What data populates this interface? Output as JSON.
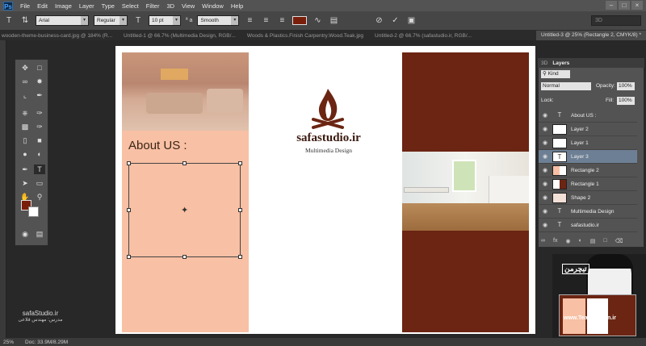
{
  "app": {
    "logo": "Ps"
  },
  "menu": [
    "File",
    "Edit",
    "Image",
    "Layer",
    "Type",
    "Select",
    "Filter",
    "3D",
    "View",
    "Window",
    "Help"
  ],
  "window_controls": [
    "–",
    "□",
    "×"
  ],
  "options": {
    "font_family": "Arial",
    "font_style": "Regular",
    "font_size": "10 pt",
    "aa_label": "ª a",
    "anti_alias": "Smooth",
    "color": "#7a1e0c",
    "workspace": "3D"
  },
  "tabs": [
    "wooden-theme-business-card.jpg @ 184% (R...",
    "Untitled-1 @ 66.7% (Multimedia Design, RGB/...",
    "Woods & Plastics.Finish Carpentry.Wood.Teak.jpg",
    "Untitled-2 @ 66.7% (safastudio.ir, RGB/...",
    "Untitled-3 @ 25% (Rectangle 2, CMYK/8) *"
  ],
  "document": {
    "heading": "About US :",
    "brand": "safastudio.ir",
    "tagline": "Multimedia Design",
    "colors": {
      "left_panel": "#f8c0a4",
      "right_panel": "#6b2512",
      "logo": "#6b2512"
    }
  },
  "layers_panel": {
    "tabs": [
      "3D",
      "Layers"
    ],
    "filter_label": "Kind",
    "blend_mode": "Normal",
    "opacity_label": "Opacity:",
    "opacity": "100%",
    "lock_label": "Lock:",
    "fill_label": "Fill:",
    "fill": "100%",
    "layers": [
      {
        "name": "About US :",
        "type": "T",
        "selected": false
      },
      {
        "name": "Layer 2",
        "type": "px",
        "selected": false
      },
      {
        "name": "Layer 1",
        "type": "px",
        "selected": false
      },
      {
        "name": "Layer 3",
        "type": "T",
        "selected": true
      },
      {
        "name": "Rectangle 2",
        "type": "px",
        "selected": false
      },
      {
        "name": "Rectangle 1",
        "type": "px",
        "selected": false
      },
      {
        "name": "Shape 2",
        "type": "px",
        "selected": false
      },
      {
        "name": "Multimedia Design",
        "type": "T",
        "selected": false
      },
      {
        "name": "safastudio.ir",
        "type": "T",
        "selected": false
      }
    ],
    "footer_icons": [
      "link-icon",
      "fx-icon",
      "mask-icon",
      "adjustment-icon",
      "folder-icon",
      "new-layer-icon",
      "trash-icon"
    ]
  },
  "status": {
    "zoom": "25%",
    "doc": "Doc: 33.9M/8.29M"
  },
  "watermark": {
    "site": "safaStudio.ir",
    "credit": "مدرس: مهندس قلاعی"
  },
  "teacher_overlay": {
    "site": "www.TeacherMan.ir",
    "brand": "تیچرمن"
  }
}
